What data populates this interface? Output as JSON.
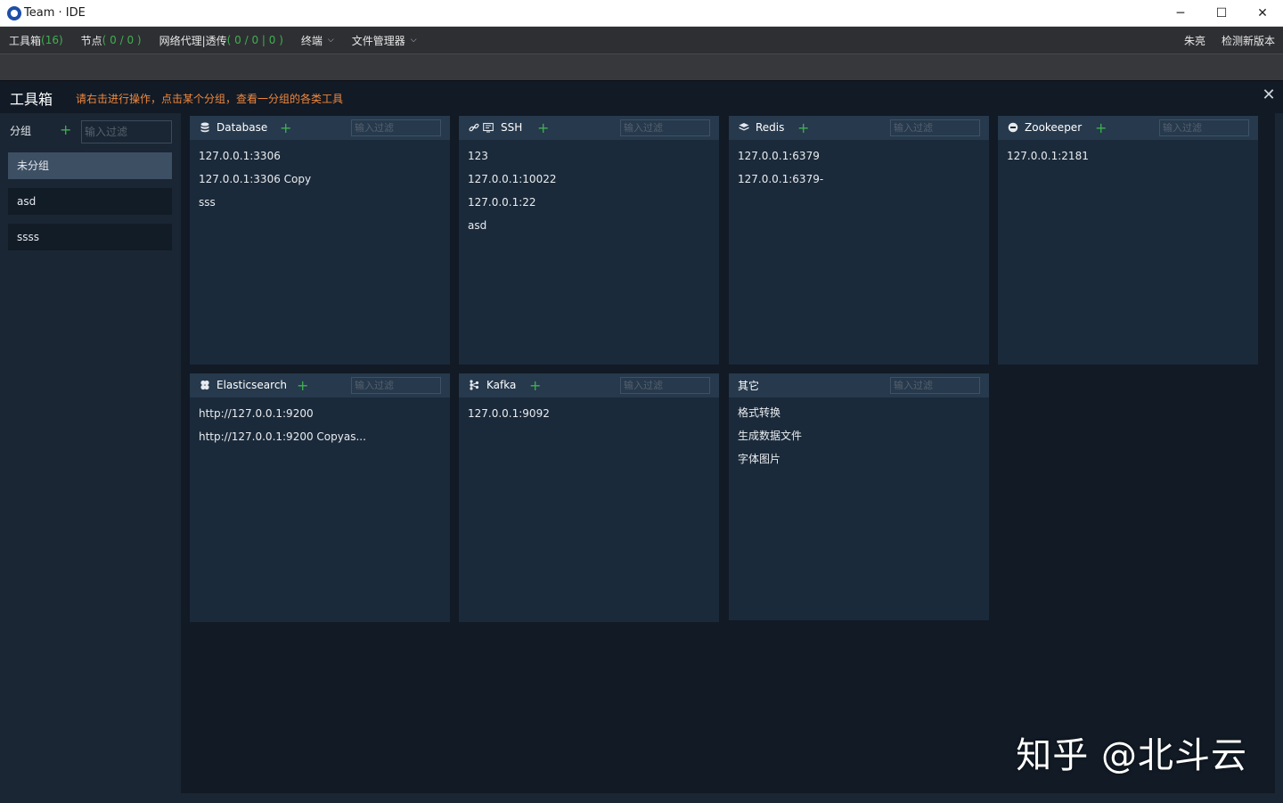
{
  "window": {
    "title": "Team · IDE",
    "minimize": "─",
    "maximize": "☐",
    "close": "✕"
  },
  "menubar": {
    "toolbox_label": "工具箱",
    "toolbox_count": "(16)",
    "nodes_label": "节点",
    "nodes_count": "( 0 / 0 )",
    "proxy_label": "网络代理|透传",
    "proxy_count": "( 0 / 0 | 0 )",
    "terminal_label": "终端",
    "file_manager_label": "文件管理器",
    "user_name": "朱亮",
    "check_update": "检测新版本"
  },
  "toolbox": {
    "title": "工具箱",
    "hint": "请右击进行操作，点击某个分组，查看一分组的各类工具",
    "close": "✕"
  },
  "groups": {
    "label": "分组",
    "add": "+",
    "filter_placeholder": "输入过滤",
    "items": [
      "未分组",
      "asd",
      "ssss"
    ]
  },
  "cards": [
    {
      "title": "Database",
      "icon": "database-icon",
      "add": "+",
      "filter_placeholder": "输入过滤",
      "items": [
        "127.0.0.1:3306",
        "127.0.0.1:3306 Copy",
        "sss"
      ]
    },
    {
      "title": "SSH",
      "icon": "ssh-icon",
      "add": "+",
      "filter_placeholder": "输入过滤",
      "items": [
        "123",
        "127.0.0.1:10022",
        "127.0.0.1:22",
        "asd"
      ]
    },
    {
      "title": "Redis",
      "icon": "redis-icon",
      "add": "+",
      "filter_placeholder": "输入过滤",
      "items": [
        "127.0.0.1:6379",
        "127.0.0.1:6379-"
      ]
    },
    {
      "title": "Zookeeper",
      "icon": "zookeeper-icon",
      "add": "+",
      "filter_placeholder": "输入过滤",
      "items": [
        "127.0.0.1:2181"
      ]
    },
    {
      "title": "Elasticsearch",
      "icon": "elasticsearch-icon",
      "add": "+",
      "filter_placeholder": "输入过滤",
      "items": [
        "http://127.0.0.1:9200",
        "http://127.0.0.1:9200 Copyas..."
      ]
    },
    {
      "title": "Kafka",
      "icon": "kafka-icon",
      "add": "+",
      "filter_placeholder": "输入过滤",
      "items": [
        "127.0.0.1:9092"
      ]
    },
    {
      "title": "其它",
      "filter_placeholder": "输入过滤",
      "items": [
        "格式转换",
        "生成数据文件",
        "字体图片"
      ]
    }
  ],
  "watermark": "知乎 @北斗云",
  "colors": {
    "accent_green": "#3fb04f",
    "hint_orange": "#f0883e",
    "panel_bg": "#1b2a3a",
    "header_bg": "#26394d"
  }
}
